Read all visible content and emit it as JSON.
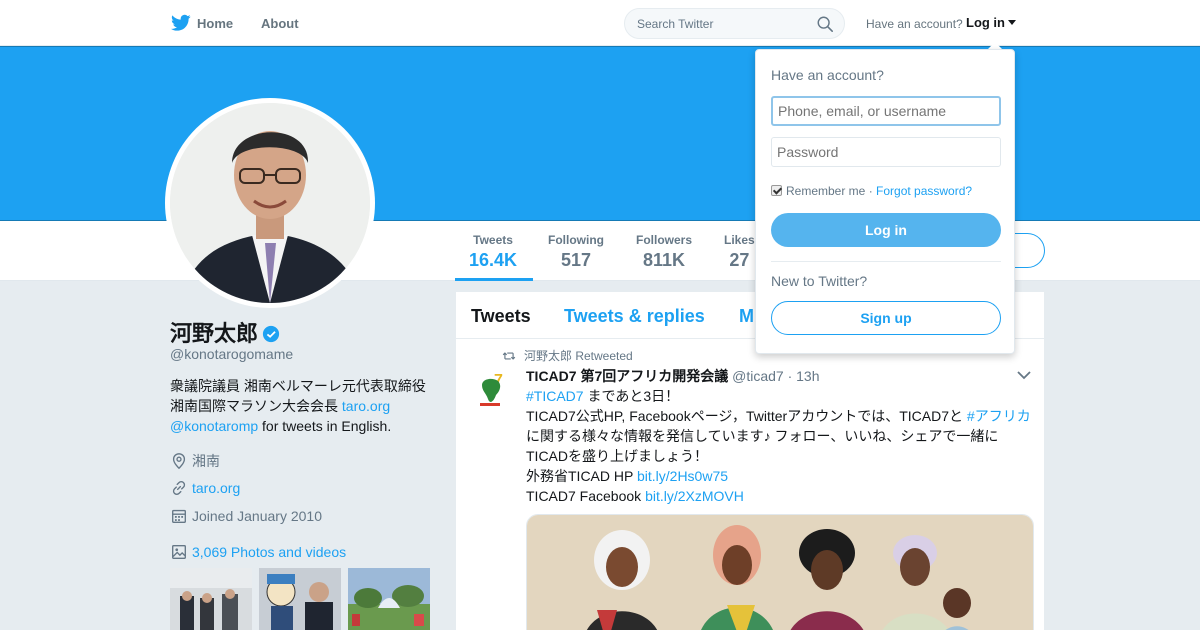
{
  "nav": {
    "home": "Home",
    "about": "About",
    "search_placeholder": "Search Twitter",
    "have_account": "Have an account?",
    "login": "Log in"
  },
  "profile": {
    "name": "河野太郎",
    "handle": "@konotarogomame",
    "bio_line1": "衆議院議員 湘南ベルマーレ元代表取締役",
    "bio_line2_text": "湘南国際マラソン大会会長 ",
    "bio_link1": "taro.org",
    "bio_mention": "@konotaromp",
    "bio_tail": " for tweets in English.",
    "location": "湘南",
    "website": "taro.org",
    "joined": "Joined January 2010",
    "photos": "3,069 Photos and videos"
  },
  "stats": [
    {
      "label": "Tweets",
      "value": "16.4K"
    },
    {
      "label": "Following",
      "value": "517"
    },
    {
      "label": "Followers",
      "value": "811K"
    },
    {
      "label": "Likes",
      "value": "27"
    }
  ],
  "timeline": {
    "tabs": [
      "Tweets",
      "Tweets & replies",
      "M"
    ],
    "tweet": {
      "retweeted_by": "河野太郎 Retweeted",
      "author_name": "TICAD7 第7回アフリカ開発会議",
      "author_handle": "@ticad7",
      "time": "· 13h",
      "hashtag1": "#TICAD7",
      "line1_tail": " まであと3日！",
      "line2_head": "TICAD7公式HP, Facebookページ，Twitterアカウントでは、TICAD7と ",
      "hashtag2": "#アフリカ",
      "line3": "に関する様々な情報を発信しています♪ フォロー、いいね、シェアで一緒に",
      "line4": "TICADを盛り上げましょう！",
      "line5_head": "外務省TICAD HP ",
      "link1": "bit.ly/2Hs0w75",
      "line6_head": "TICAD7 Facebook ",
      "link2": "bit.ly/2XzMOVH"
    }
  },
  "login_dropdown": {
    "title": "Have an account?",
    "username_placeholder": "Phone, email, or username",
    "password_placeholder": "Password",
    "remember": "Remember me",
    "separator": " · ",
    "forgot": "Forgot password?",
    "login_button": "Log in",
    "new_to_twitter": "New to Twitter?",
    "signup_button": "Sign up"
  },
  "colors": {
    "brand": "#1da1f2",
    "banner": "#1da1f2",
    "background": "#e6ecf0"
  },
  "icons": [
    "twitter-bird-icon",
    "search-icon",
    "verified-badge-icon",
    "location-icon",
    "link-icon",
    "calendar-icon",
    "photo-icon",
    "retweet-icon",
    "chevron-down-icon"
  ]
}
